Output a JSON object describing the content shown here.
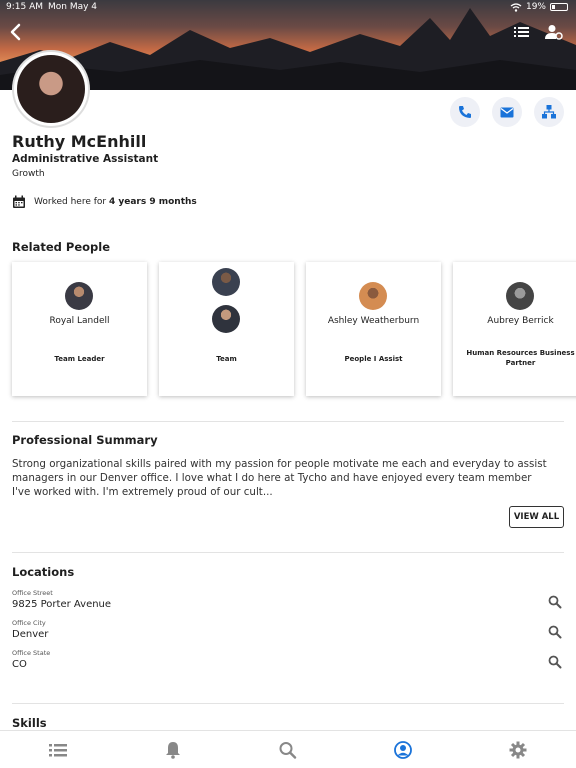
{
  "status_bar": {
    "time": "9:15 AM",
    "date": "Mon May 4",
    "battery": "19%"
  },
  "header": {
    "icons": [
      "back-chevron-icon",
      "list-icon",
      "person-settings-icon"
    ]
  },
  "profile": {
    "name": "Ruthy McEnhill",
    "title": "Administrative Assistant",
    "department": "Growth",
    "tenure_prefix": "Worked here for",
    "tenure_value": "4 years 9 months"
  },
  "actions": [
    "phone-icon",
    "mail-icon",
    "org-chart-icon"
  ],
  "related": {
    "title": "Related People",
    "cards": [
      {
        "name": "Royal Landell",
        "relation": "Team Leader"
      },
      {
        "name": "",
        "relation": "Team"
      },
      {
        "name": "Ashley Weatherburn",
        "relation": "People I Assist"
      },
      {
        "name": "Aubrey Berrick",
        "relation": "Human Resources Business Partner"
      }
    ]
  },
  "summary": {
    "title": "Professional Summary",
    "text": "Strong organizational skills paired with my passion for people motivate me each and everyday to assist managers in our Denver office. I love what I do here at Tycho and have enjoyed every team member I've worked with. I'm extremely proud of our cult...",
    "view_all": "VIEW ALL"
  },
  "locations": {
    "title": "Locations",
    "items": [
      {
        "label": "Office Street",
        "value": "9825 Porter Avenue"
      },
      {
        "label": "Office City",
        "value": "Denver"
      },
      {
        "label": "Office State",
        "value": "CO"
      }
    ]
  },
  "skills": {
    "title": "Skills"
  },
  "tabbar": {
    "icons": [
      "list-icon",
      "bell-icon",
      "search-icon",
      "profile-icon",
      "gear-icon"
    ],
    "active": "profile-icon",
    "active_color": "#1a73d9"
  }
}
